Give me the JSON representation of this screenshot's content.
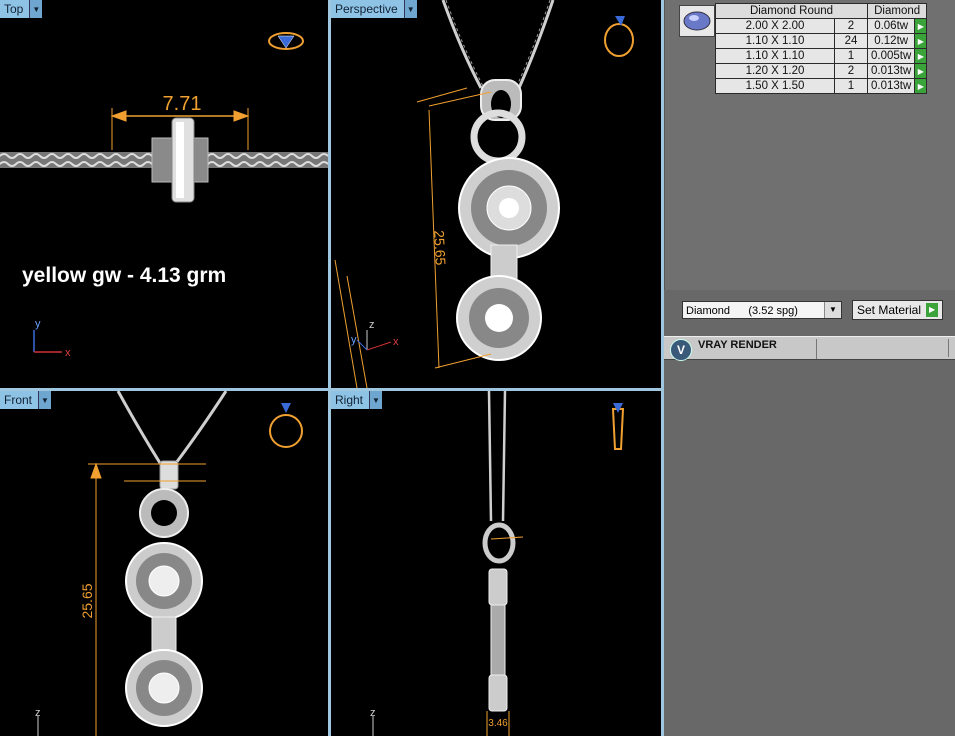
{
  "viewports": {
    "top": {
      "label": "Top",
      "dimension": "7.71",
      "weight_text": "yellow gw - 4.13 grm",
      "axis_x": "x",
      "axis_y": "y"
    },
    "perspective": {
      "label": "Perspective",
      "dimension": "25.65",
      "axis_x": "x",
      "axis_y": "y",
      "axis_z": "z"
    },
    "front": {
      "label": "Front",
      "dimension": "25.65",
      "axis_z": "z"
    },
    "right": {
      "label": "Right",
      "dimension": "3.46",
      "axis_z": "z"
    }
  },
  "stones": {
    "header_size": "Diamond Round",
    "header_material": "Diamond",
    "rows": [
      {
        "size": "2.00 X 2.00",
        "count": "2",
        "weight": "0.06tw"
      },
      {
        "size": "1.10 X 1.10",
        "count": "24",
        "weight": "0.12tw"
      },
      {
        "size": "1.10 X 1.10",
        "count": "1",
        "weight": "0.005tw"
      },
      {
        "size": "1.20 X 1.20",
        "count": "2",
        "weight": "0.013tw"
      },
      {
        "size": "1.50 X 1.50",
        "count": "1",
        "weight": "0.013tw"
      }
    ]
  },
  "material": {
    "selected": "Diamond      (3.52 spg)",
    "set_label": "Set Material"
  },
  "render": {
    "label": "VRAY RENDER",
    "logo": "V"
  },
  "colors": {
    "dimension": "#f0a030",
    "viewport_border": "#9fc7e0",
    "go_button": "#3aa43a"
  }
}
